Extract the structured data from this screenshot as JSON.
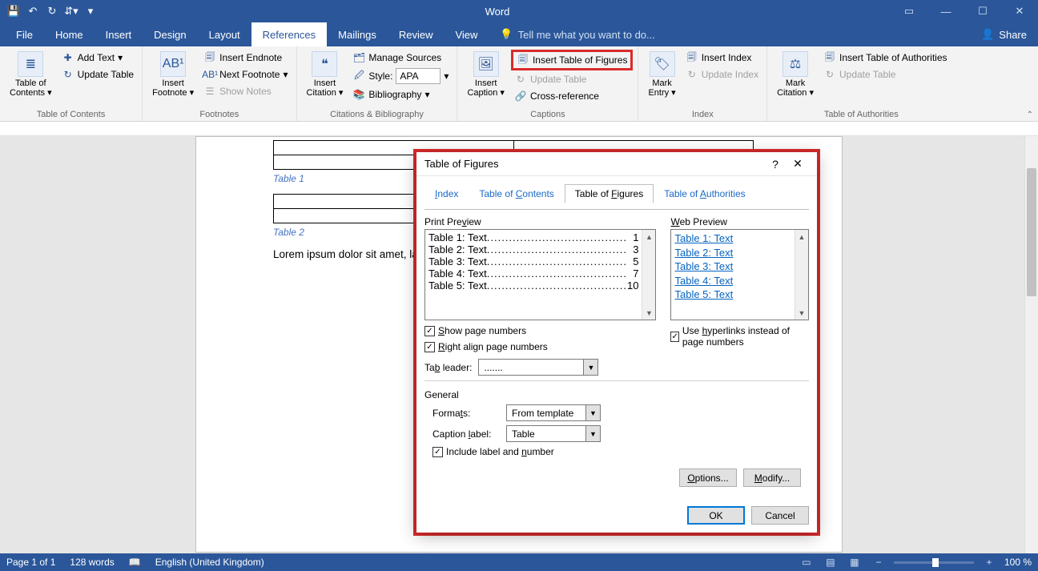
{
  "app": {
    "title": "Word"
  },
  "qat": {
    "save": "💾",
    "undo": "↶",
    "redo": "↻",
    "touch": "✋"
  },
  "tabs": [
    "File",
    "Home",
    "Insert",
    "Design",
    "Layout",
    "References",
    "Mailings",
    "Review",
    "View"
  ],
  "active_tab": "References",
  "tellme": "Tell me what you want to do...",
  "share": "Share",
  "ribbon": {
    "toc": {
      "big": "Table of\nContents",
      "add_text": "Add Text",
      "update": "Update Table",
      "group": "Table of Contents"
    },
    "fn": {
      "big": "Insert\nFootnote",
      "endnote": "Insert Endnote",
      "next": "Next Footnote",
      "show": "Show Notes",
      "group": "Footnotes"
    },
    "cit": {
      "big": "Insert\nCitation",
      "manage": "Manage Sources",
      "style_lbl": "Style:",
      "style_val": "APA",
      "bib": "Bibliography",
      "group": "Citations & Bibliography"
    },
    "cap": {
      "big": "Insert\nCaption",
      "insert_tof": "Insert Table of Figures",
      "update": "Update Table",
      "xref": "Cross-reference",
      "group": "Captions"
    },
    "idx": {
      "big": "Mark\nEntry",
      "insert": "Insert Index",
      "update": "Update Index",
      "group": "Index"
    },
    "toa": {
      "big": "Mark\nCitation",
      "insert": "Insert Table of Authorities",
      "update": "Update Table",
      "group": "Table of Authorities"
    }
  },
  "doc": {
    "caption1": "Table 1",
    "caption2": "Table 2",
    "para": "Lorem ipsum dolor sit amet, labore et dolore magna aliqu"
  },
  "dialog": {
    "title": "Table of Figures",
    "tabs": [
      "Index",
      "Table of Contents",
      "Table of Figures",
      "Table of Authorities"
    ],
    "active_tab": "Table of Figures",
    "print_preview_lbl": "Print Preview",
    "web_preview_lbl": "Web Preview",
    "print_entries": [
      {
        "label": "Table 1: Text",
        "page": "1"
      },
      {
        "label": "Table 2: Text",
        "page": "3"
      },
      {
        "label": "Table 3: Text",
        "page": "5"
      },
      {
        "label": "Table 4: Text",
        "page": "7"
      },
      {
        "label": "Table 5: Text",
        "page": "10"
      }
    ],
    "web_entries": [
      "Table 1: Text",
      "Table 2: Text",
      "Table 3: Text",
      "Table 4: Text",
      "Table 5: Text"
    ],
    "chk_show_pages": "Show page numbers",
    "chk_right_align": "Right align page numbers",
    "chk_hyperlinks": "Use hyperlinks instead of page numbers",
    "tab_leader_lbl": "Tab leader:",
    "tab_leader_val": ".......",
    "general_lbl": "General",
    "formats_lbl": "Formats:",
    "formats_val": "From template",
    "caption_lbl_lbl": "Caption label:",
    "caption_lbl_val": "Table",
    "chk_include": "Include label and number",
    "options_btn": "Options...",
    "modify_btn": "Modify...",
    "ok_btn": "OK",
    "cancel_btn": "Cancel"
  },
  "status": {
    "page": "Page 1 of 1",
    "words": "128 words",
    "lang": "English (United Kingdom)",
    "zoom": "100 %"
  }
}
